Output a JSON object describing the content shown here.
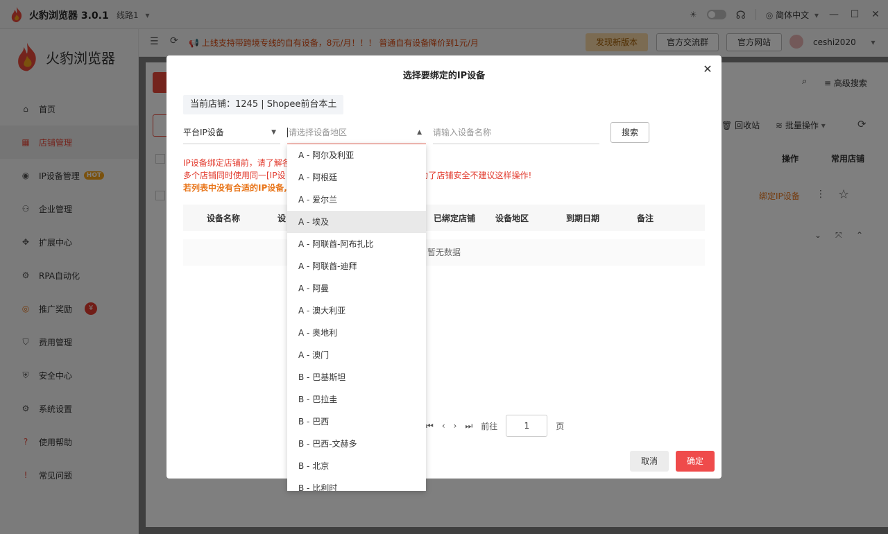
{
  "app": {
    "name": "火豹浏览器 3.0.1",
    "line_selector": "线路1",
    "language": "简体中文"
  },
  "sidebar": {
    "brand": "火豹浏览器",
    "items": [
      {
        "label": "首页",
        "icon": "home-icon"
      },
      {
        "label": "店铺管理",
        "icon": "grid-icon",
        "active": true
      },
      {
        "label": "IP设备管理",
        "icon": "location-icon",
        "badge": "HOT"
      },
      {
        "label": "企业管理",
        "icon": "users-icon"
      },
      {
        "label": "扩展中心",
        "icon": "puzzle-icon"
      },
      {
        "label": "RPA自动化",
        "icon": "robot-icon"
      },
      {
        "label": "推广奖励",
        "icon": "reward-icon",
        "badge": "¥"
      },
      {
        "label": "费用管理",
        "icon": "fee-icon"
      },
      {
        "label": "安全中心",
        "icon": "shield-icon"
      },
      {
        "label": "系统设置",
        "icon": "gear-icon"
      },
      {
        "label": "使用帮助",
        "icon": "help-icon"
      },
      {
        "label": "常见问题",
        "icon": "info-icon"
      }
    ]
  },
  "header": {
    "announcement": "上线支持带跨境专线的自有设备，8元/月！！！ 普通自有设备降价到1元/月",
    "new_version": "发现新版本",
    "community": "官方交流群",
    "website": "官方网站",
    "user": "ceshi2020"
  },
  "main_bg": {
    "advanced_search": "高级搜索",
    "recycle": "回收站",
    "batch": "批量操作",
    "col_action": "操作",
    "col_common": "常用店铺",
    "bind_link": "绑定IP设备"
  },
  "dialog": {
    "title": "选择要绑定的IP设备",
    "current_shop": "当前店铺：1245 | Shopee前台本土",
    "platform_select": "平台IP设备",
    "region_placeholder": "请选择设备地区",
    "name_placeholder": "请输入设备名称",
    "search_btn": "搜索",
    "warn_line1": "IP设备绑定店铺前，请了解各",
    "warn_line2a": "多个店铺同时使用同一[IP设",
    "warn_line2b": "是，为了店铺安全不建议这样操作!",
    "warn_line3": "若列表中没有合适的IP设备,",
    "columns": [
      "设备名称",
      "设",
      "已绑定店铺",
      "设备地区",
      "到期日期",
      "备注"
    ],
    "no_data": "暂无数据",
    "pager": {
      "goto": "前往",
      "page": "1",
      "unit": "页"
    },
    "cancel": "取消",
    "confirm": "确定"
  },
  "dropdown": {
    "options": [
      "A - 阿尔及利亚",
      "A - 阿根廷",
      "A - 爱尔兰",
      "A - 埃及",
      "A - 阿联酋-阿布扎比",
      "A - 阿联酋-迪拜",
      "A - 阿曼",
      "A - 澳大利亚",
      "A - 奥地利",
      "A - 澳门",
      "B - 巴基斯坦",
      "B - 巴拉圭",
      "B - 巴西",
      "B - 巴西-文赫多",
      "B - 北京",
      "B - 比利时"
    ],
    "hovered_index": 3
  },
  "colors": {
    "accent": "#e8493a",
    "warning": "#e8751a",
    "confirm": "#ef4b4b"
  }
}
